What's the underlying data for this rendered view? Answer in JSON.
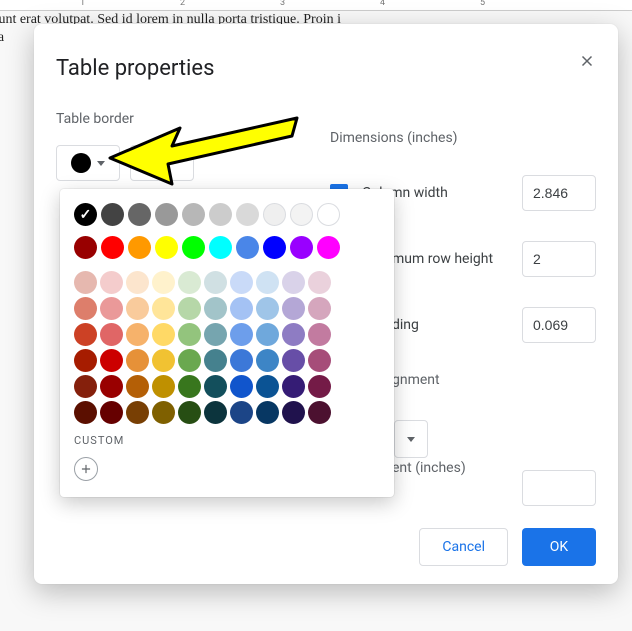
{
  "bg": {
    "line1": "at. Enim eget dui. Tincidunt erat volutpat. Sed id lorem in nulla porta tristique. Proin i",
    "line2": "iqua"
  },
  "dialog": {
    "title": "Table properties",
    "close_aria": "Close",
    "left": {
      "label": "Table border"
    },
    "right": {
      "label": "Dimensions  (inches)",
      "col_width_label": "Column width",
      "col_width_value": "2.846",
      "row_height_label_visible": "mum row height",
      "row_height_value": "2",
      "padding_label_visible": "ding",
      "padding_value": "0.069",
      "valign_label_visible": "gnment",
      "indent_label_visible": "ent  (inches)"
    },
    "footer": {
      "cancel": "Cancel",
      "ok": "OK"
    }
  },
  "palette": {
    "custom_label": "CUSTOM",
    "grays": [
      "#000000",
      "#434343",
      "#666666",
      "#999999",
      "#b7b7b7",
      "#cccccc",
      "#d9d9d9",
      "#efefef",
      "#f3f3f3",
      "#ffffff"
    ],
    "brights": [
      "#980000",
      "#ff0000",
      "#ff9900",
      "#ffff00",
      "#00ff00",
      "#00ffff",
      "#4a86e8",
      "#0000ff",
      "#9900ff",
      "#ff00ff"
    ],
    "shades": [
      [
        "#e6b8af",
        "#f4cccc",
        "#fce5cd",
        "#fff2cc",
        "#d9ead3",
        "#d0e0e3",
        "#c9daf8",
        "#cfe2f3",
        "#d9d2e9",
        "#ead1dc"
      ],
      [
        "#dd7e6b",
        "#ea9999",
        "#f9cb9c",
        "#ffe599",
        "#b6d7a8",
        "#a2c4c9",
        "#a4c2f4",
        "#9fc5e8",
        "#b4a7d6",
        "#d5a6bd"
      ],
      [
        "#cc4125",
        "#e06666",
        "#f6b26b",
        "#ffd966",
        "#93c47d",
        "#76a5af",
        "#6d9eeb",
        "#6fa8dc",
        "#8e7cc3",
        "#c27ba0"
      ],
      [
        "#a61c00",
        "#cc0000",
        "#e69138",
        "#f1c232",
        "#6aa84f",
        "#45818e",
        "#3c78d8",
        "#3d85c6",
        "#674ea7",
        "#a64d79"
      ],
      [
        "#85200c",
        "#990000",
        "#b45f06",
        "#bf9000",
        "#38761d",
        "#134f5c",
        "#1155cc",
        "#0b5394",
        "#351c75",
        "#741b47"
      ],
      [
        "#5b0f00",
        "#660000",
        "#783f04",
        "#7f6000",
        "#274e13",
        "#0c343d",
        "#1c4587",
        "#073763",
        "#20124d",
        "#4c1130"
      ]
    ]
  }
}
